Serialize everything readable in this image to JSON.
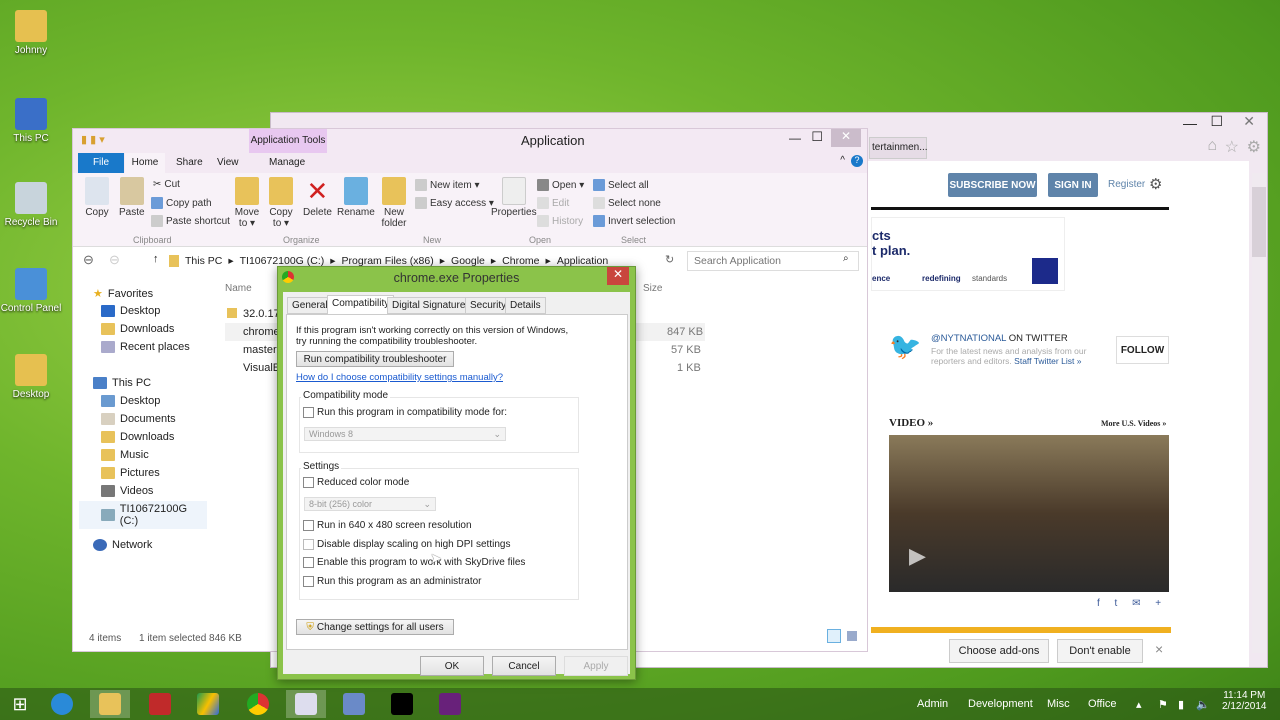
{
  "desktop": {
    "icons": [
      {
        "label": "Johnny"
      },
      {
        "label": "This PC"
      },
      {
        "label": "Recycle Bin"
      },
      {
        "label": "Control Panel"
      },
      {
        "label": "Desktop"
      }
    ]
  },
  "browser": {
    "tab": "tertainmen...",
    "subscribe": "SUBSCRIBE NOW",
    "signin": "SIGN IN",
    "register": "Register",
    "ad_line1": "cts",
    "ad_line2": "t plan.",
    "ad_left": "ence",
    "ad_tag1": "redefining",
    "ad_tag2": "standards",
    "ad_logo": "AXA",
    "twitter_handle": "@NYTNATIONAL",
    "twitter_on": "ON TWITTER",
    "twitter_desc1": "For the latest news and analysis from our",
    "twitter_desc2": "reporters and editors.",
    "twitter_link": "Staff Twitter List »",
    "follow": "FOLLOW",
    "video_heading": "VIDEO »",
    "more_videos": "More U.S. Videos »",
    "addon_choose": "Choose add-ons",
    "addon_dont": "Don't enable",
    "addon_close": "×"
  },
  "explorer": {
    "title": "Application",
    "context_tab": "Application Tools",
    "tabs": [
      "File",
      "Home",
      "Share",
      "View",
      "Manage"
    ],
    "ribbon": {
      "copy": "Copy",
      "paste": "Paste",
      "cut": "Cut",
      "copy_path": "Copy path",
      "paste_shortcut": "Paste shortcut",
      "clipboard": "Clipboard",
      "move_to": "Move to ▾",
      "copy_to": "Copy to ▾",
      "delete": "Delete",
      "rename": "Rename",
      "organize": "Organize",
      "new_folder": "New folder",
      "new_item": "New item ▾",
      "easy_access": "Easy access ▾",
      "new": "New",
      "properties": "Properties",
      "open": "Open ▾",
      "edit": "Edit",
      "history": "History",
      "open_group": "Open",
      "select_all": "Select all",
      "select_none": "Select none",
      "invert": "Invert selection",
      "select": "Select"
    },
    "breadcrumb": [
      "This PC",
      "TI10672100G (C:)",
      "Program Files (x86)",
      "Google",
      "Chrome",
      "Application"
    ],
    "search_placeholder": "Search Application",
    "nav": {
      "favorites": "Favorites",
      "fav_items": [
        "Desktop",
        "Downloads",
        "Recent places"
      ],
      "thispc": "This PC",
      "pc_items": [
        "Desktop",
        "Documents",
        "Downloads",
        "Music",
        "Pictures",
        "Videos",
        "TI10672100G (C:)"
      ],
      "network": "Network"
    },
    "columns": {
      "name": "Name",
      "size": "Size"
    },
    "files": [
      {
        "name": "32.0.17",
        "size": ""
      },
      {
        "name": "chrome",
        "size": "847 KB"
      },
      {
        "name": "master",
        "size": "57 KB"
      },
      {
        "name": "VisualE",
        "size": "1 KB"
      }
    ],
    "status": {
      "items": "4 items",
      "selected": "1 item selected  846 KB"
    }
  },
  "dialog": {
    "title": "chrome.exe Properties",
    "tabs": [
      "General",
      "Compatibility",
      "Digital Signatures",
      "Security",
      "Details"
    ],
    "active_tab": "Compatibility",
    "intro": "If this program isn't working correctly on this version of Windows, try running the compatibility troubleshooter.",
    "run_troubleshooter": "Run compatibility troubleshooter",
    "help_link": "How do I choose compatibility settings manually?",
    "compat_mode_label": "Compatibility mode",
    "compat_checkbox": "Run this program in compatibility mode for:",
    "compat_select": "Windows 8",
    "settings_label": "Settings",
    "reduced_color": "Reduced color mode",
    "color_select": "8-bit (256) color",
    "res640": "Run in 640 x 480 screen resolution",
    "dpi": "Disable display scaling on high DPI settings",
    "skydrive": "Enable this program to work with SkyDrive files",
    "admin": "Run this program as an administrator",
    "change_all": "Change settings for all users",
    "ok": "OK",
    "cancel": "Cancel",
    "apply": "Apply"
  },
  "taskbar": {
    "toolbars": [
      "Admin",
      "Development",
      "Misc",
      "Office"
    ],
    "time": "11:14 PM",
    "date": "2/12/2014"
  }
}
